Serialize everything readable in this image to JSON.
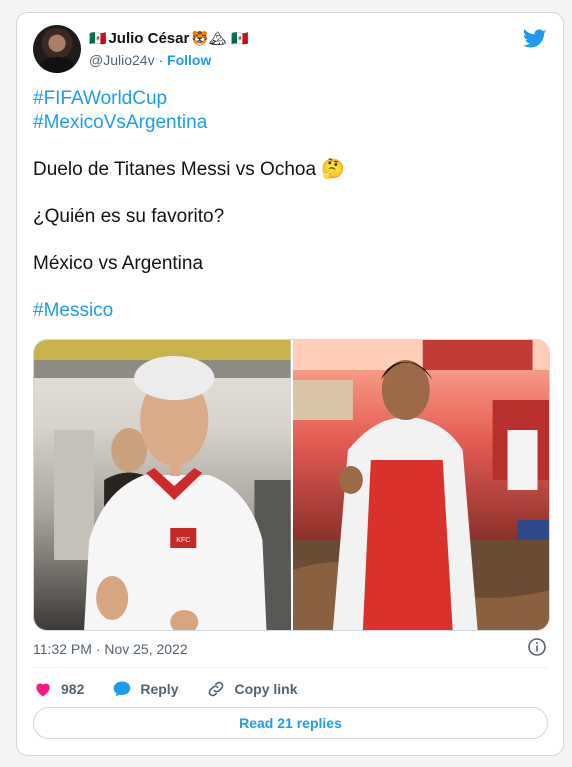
{
  "author": {
    "display_name": "Julio César",
    "name_emojis_pre": "🇲🇽",
    "name_emojis_post": "🐯🏔 🇲🇽",
    "handle": "@Julio24v",
    "separator": " · ",
    "follow_label": "Follow"
  },
  "tweet": {
    "line1": "#FIFAWorldCup",
    "line2": "#MexicoVsArgentina",
    "line3": "Duelo de Titanes Messi vs Ochoa 🤔",
    "line4": "¿Quién es su favorito?",
    "line5": "México vs Argentina",
    "line6": "#Messico"
  },
  "media": {
    "photo_left_logo": "KFC"
  },
  "meta": {
    "time": "11:32 PM",
    "dot": " · ",
    "date": "Nov 25, 2022"
  },
  "actions": {
    "likes": "982",
    "reply_label": "Reply",
    "copy_label": "Copy link"
  },
  "read_replies_label": "Read 21 replies",
  "colors": {
    "accent": "#1d9bf0",
    "like": "#f91880",
    "text": "#0f1419",
    "muted": "#536471"
  },
  "icons": [
    "twitter-bird-icon",
    "info-icon",
    "heart-icon",
    "reply-bubble-icon",
    "link-icon"
  ]
}
